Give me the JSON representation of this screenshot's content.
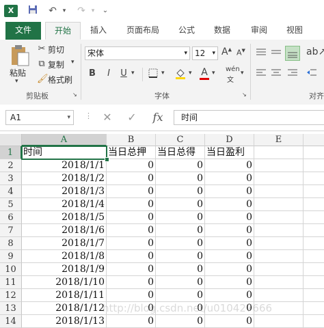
{
  "qat": {
    "logo": "X",
    "save_icon": "save-icon",
    "undo_icon": "undo-icon",
    "redo_icon": "redo-icon"
  },
  "tabs": [
    {
      "label": "文件"
    },
    {
      "label": "开始"
    },
    {
      "label": "插入"
    },
    {
      "label": "页面布局"
    },
    {
      "label": "公式"
    },
    {
      "label": "数据"
    },
    {
      "label": "审阅"
    },
    {
      "label": "视图"
    }
  ],
  "ribbon": {
    "clipboard": {
      "paste_label": "粘贴",
      "cut_label": "剪切",
      "copy_label": "复制",
      "format_painter_label": "格式刷",
      "group_label": "剪贴板"
    },
    "font": {
      "font_name": "宋体",
      "font_size": "12",
      "grow_label": "A",
      "shrink_label": "A",
      "bold": "B",
      "italic": "I",
      "underline": "U",
      "font_color_label": "A",
      "phonetic_label": "wén",
      "group_label": "字体"
    },
    "align_group_label": "对齐"
  },
  "formula_bar": {
    "name_box": "A1",
    "fx_label": "fx",
    "content": "时间"
  },
  "columns": [
    "A",
    "B",
    "C",
    "D",
    "E"
  ],
  "rows": [
    {
      "n": "1",
      "a": "时间",
      "b": "当日总押",
      "c": "当日总得",
      "d": "当日盈利"
    },
    {
      "n": "2",
      "a": "2018/1/1",
      "b": "0",
      "c": "0",
      "d": "0"
    },
    {
      "n": "3",
      "a": "2018/1/2",
      "b": "0",
      "c": "0",
      "d": "0"
    },
    {
      "n": "4",
      "a": "2018/1/3",
      "b": "0",
      "c": "0",
      "d": "0"
    },
    {
      "n": "5",
      "a": "2018/1/4",
      "b": "0",
      "c": "0",
      "d": "0"
    },
    {
      "n": "6",
      "a": "2018/1/5",
      "b": "0",
      "c": "0",
      "d": "0"
    },
    {
      "n": "7",
      "a": "2018/1/6",
      "b": "0",
      "c": "0",
      "d": "0"
    },
    {
      "n": "8",
      "a": "2018/1/7",
      "b": "0",
      "c": "0",
      "d": "0"
    },
    {
      "n": "9",
      "a": "2018/1/8",
      "b": "0",
      "c": "0",
      "d": "0"
    },
    {
      "n": "10",
      "a": "2018/1/9",
      "b": "0",
      "c": "0",
      "d": "0"
    },
    {
      "n": "11",
      "a": "2018/1/10",
      "b": "0",
      "c": "0",
      "d": "0"
    },
    {
      "n": "12",
      "a": "2018/1/11",
      "b": "0",
      "c": "0",
      "d": "0"
    },
    {
      "n": "13",
      "a": "2018/1/12",
      "b": "0",
      "c": "0",
      "d": "0"
    },
    {
      "n": "14",
      "a": "2018/1/13",
      "b": "0",
      "c": "0",
      "d": "0"
    }
  ],
  "watermark": "http://blog.csdn.net/u010427666",
  "colors": {
    "accent": "#217346",
    "ribbon_bg": "#f3f3f3"
  }
}
